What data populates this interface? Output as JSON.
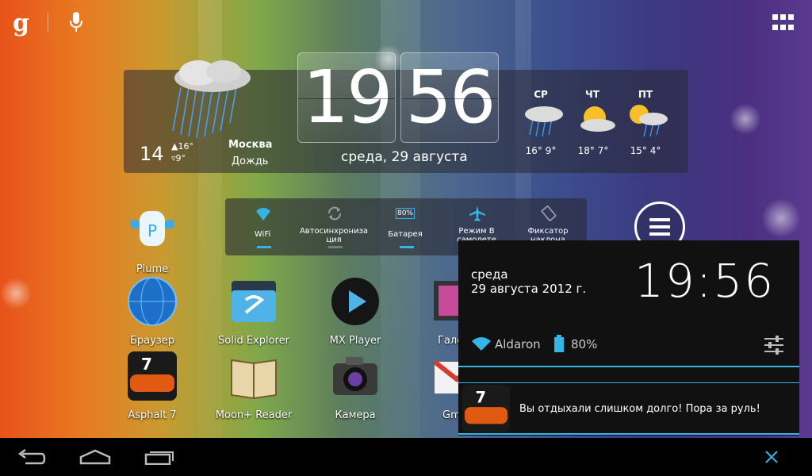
{
  "topbar": {
    "google_logo": "g",
    "mic_icon": "mic-icon",
    "apps_icon": "all-apps-icon"
  },
  "clock_widget": {
    "hours": "19",
    "minutes": "56",
    "date": "среда, 29 августа"
  },
  "weather": {
    "current_temp": "14",
    "high": "▲16°",
    "low": "▿9°",
    "city": "Москва",
    "condition": "Дождь",
    "forecast": [
      {
        "day": "СР",
        "temps": "16° 9°",
        "icon": "rain-icon"
      },
      {
        "day": "ЧТ",
        "temps": "18° 7°",
        "icon": "sun-cloud-icon"
      },
      {
        "day": "ПТ",
        "temps": "15° 4°",
        "icon": "sun-rain-icon"
      }
    ]
  },
  "quick_settings": [
    {
      "label": "WiFi",
      "active": true
    },
    {
      "label": "Автосинхрониза ция",
      "active": false
    },
    {
      "label": "Батарея",
      "badge": "80%",
      "active": true
    },
    {
      "label": "Режим В самолете",
      "active": false
    },
    {
      "label": "Фиксатор наклона",
      "active": false
    }
  ],
  "apps": [
    {
      "name": "Plume"
    },
    {
      "name": "Браузер"
    },
    {
      "name": "Solid Explorer"
    },
    {
      "name": "MX Player"
    },
    {
      "name": "Гале"
    },
    {
      "name": "Asphalt 7"
    },
    {
      "name": "Moon+ Reader"
    },
    {
      "name": "Камера"
    },
    {
      "name": "Gm"
    }
  ],
  "notification_panel": {
    "day": "среда",
    "date": "29 августа 2012 г.",
    "time": "19:56",
    "network": "Aldaron",
    "battery": "80%",
    "message": "Вы отдыхали слишком долго! Пора за руль!"
  },
  "navbar": {
    "back": "back-icon",
    "home": "home-icon",
    "recents": "recents-icon",
    "close": "close-icon"
  },
  "colors": {
    "accent": "#33b5e5",
    "panel": "#111111"
  }
}
